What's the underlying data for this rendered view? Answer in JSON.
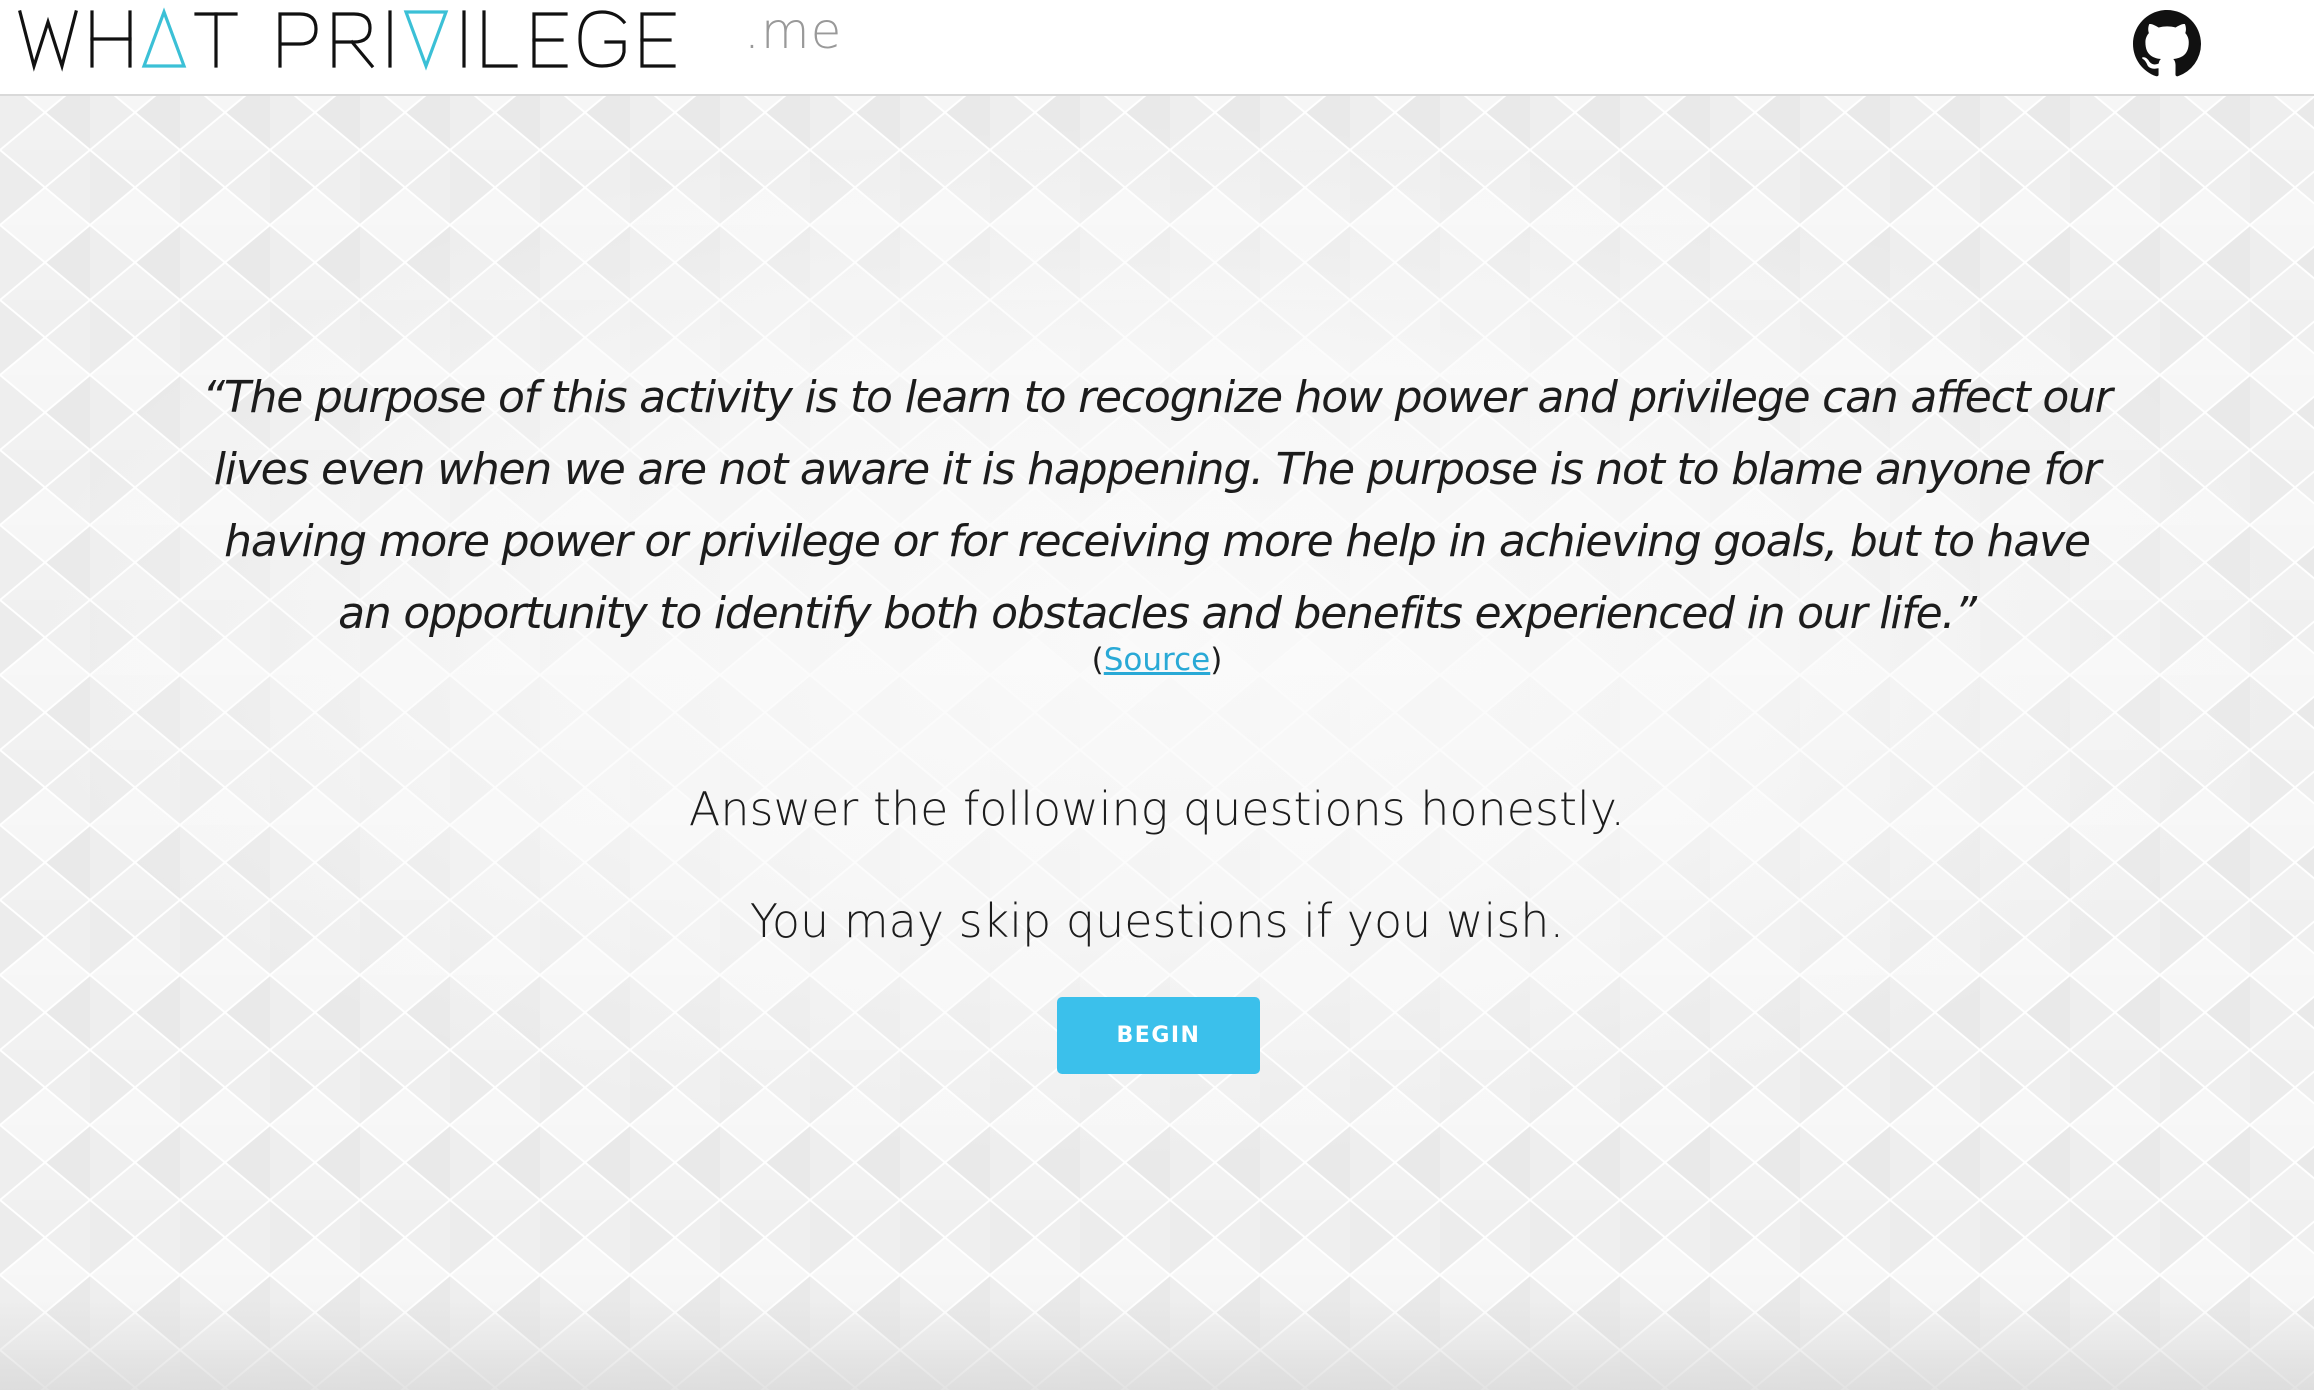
{
  "header": {
    "logo_text": "WHAT PRIVILEGE",
    "logo_tld": ".me",
    "accent_color": "#3bc0d6",
    "github_icon": "github-icon"
  },
  "main": {
    "quote": "“The purpose of this activity is to learn to recognize how power and privilege can affect our lives even when we are not aware it is happening. The purpose is not to blame anyone for having more power or privilege or for receiving more help in achieving goals, but to have an opportunity to identify both obstacles and benefits experienced in our life.”",
    "source_open": "(",
    "source_link": "Source",
    "source_close": ")",
    "instruction_1": "Answer the following questions honestly.",
    "instruction_2": "You may skip questions if you wish.",
    "begin_label": "BEGIN",
    "button_color": "#3bc0eb",
    "link_color": "#29a9d6"
  }
}
